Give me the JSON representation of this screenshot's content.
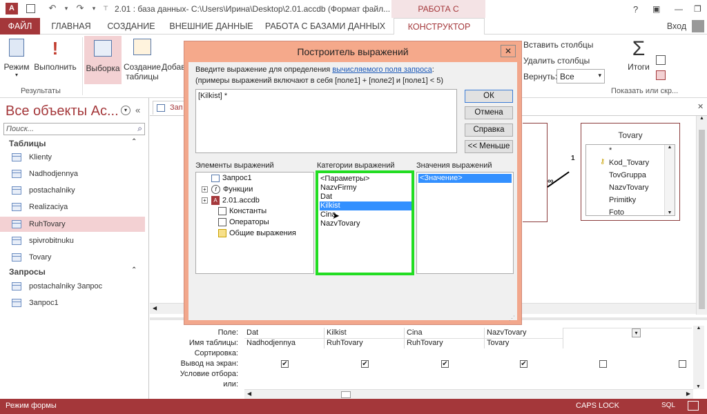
{
  "titlebar": {
    "title": "2.01 : база данных- C:\\Users\\Ирина\\Desktop\\2.01.accdb (Формат файл...",
    "context_tab": "РАБОТА С ЗАПРОСАМИ",
    "help": "?",
    "login": "Вход"
  },
  "tabs": [
    "ФАЙЛ",
    "ГЛАВНАЯ",
    "СОЗДАНИЕ",
    "ВНЕШНИЕ ДАННЫЕ",
    "РАБОТА С БАЗАМИ ДАННЫХ",
    "КОНСТРУКТОР"
  ],
  "ribbon": {
    "mode": "Режим",
    "run": "Выполнить",
    "group_results": "Результаты",
    "select": "Выборка",
    "make_table_1": "Создание",
    "make_table_2": "таблицы",
    "append": "Добав",
    "insert_cols": "Вставить столбцы",
    "delete_cols": "Удалить столбцы",
    "return_label": "Вернуть:",
    "return_value": "Все",
    "totals": "Итоги",
    "show_hide": "Показать или скр..."
  },
  "nav": {
    "title": "Все объекты Ac...",
    "search_placeholder": "Поиск...",
    "section_tables": "Таблицы",
    "tables": [
      "Klienty",
      "Nadhodjennya",
      "postachalniky",
      "Realizaciya",
      "RuhTovary",
      "spivrobitnuku",
      "Tovary"
    ],
    "section_queries": "Запросы",
    "queries": [
      "postachalniky Запрос",
      "Запрос1"
    ]
  },
  "work": {
    "tab_label": "Зап",
    "table_box": {
      "title": "Tovary",
      "fields": [
        "*",
        "Kod_Tovary",
        "TovGruppa",
        "NazvTovary",
        "Primitky",
        "Foto"
      ]
    },
    "rel_one": "1",
    "rel_many": "∞"
  },
  "dialog": {
    "title": "Построитель выражений",
    "prompt_text": "Введите выражение для определения ",
    "prompt_link": "вычисляемого поля запроса",
    "prompt_colon": ":",
    "examples": "(примеры выражений включают в себя [поле1] + [поле2] и [поле1] < 5)",
    "expression": "[Kilkist] *",
    "btn_ok": "ОК",
    "btn_cancel": "Отмена",
    "btn_help": "Справка",
    "btn_less": "<< Меньше",
    "col_elements": "Элементы выражений",
    "col_categories": "Категории выражений",
    "col_values": "Значения выражений",
    "elements": [
      "Запрос1",
      "Функции",
      "2.01.accdb",
      "Константы",
      "Операторы",
      "Общие выражения"
    ],
    "categories": [
      "<Параметры>",
      "NazvFirmy",
      "Dat",
      "Kilkist",
      "Cina",
      "NazvTovary"
    ],
    "selected_category": "Kilkist",
    "values": [
      "<Значение>"
    ],
    "highlight_color": "#22dd22"
  },
  "grid": {
    "labels": [
      "Поле:",
      "Имя таблицы:",
      "Сортировка:",
      "Вывод на экран:",
      "Условие отбора:",
      "или:"
    ],
    "columns": [
      {
        "field": "Dat",
        "table": "Nadhodjennya",
        "show": true
      },
      {
        "field": "Kilkist",
        "table": "RuhTovary",
        "show": true
      },
      {
        "field": "Cina",
        "table": "RuhTovary",
        "show": true
      },
      {
        "field": "NazvTovary",
        "table": "Tovary",
        "show": true
      },
      {
        "field": "",
        "table": "",
        "show": false
      },
      {
        "field": "",
        "table": "",
        "show": false
      }
    ]
  },
  "status": {
    "left": "Режим формы",
    "caps": "CAPS LOCK",
    "sql": "SQL"
  }
}
